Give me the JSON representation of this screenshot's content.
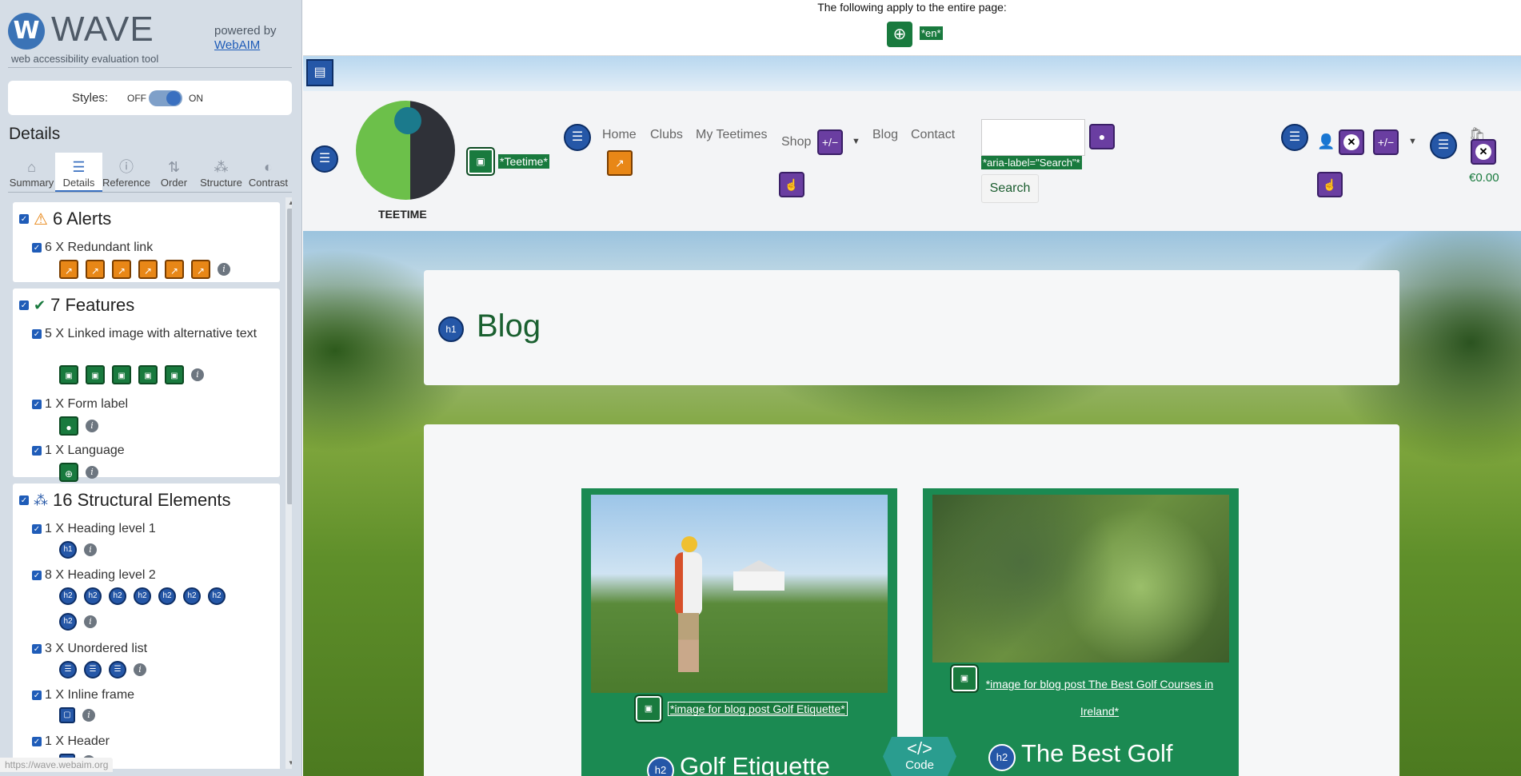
{
  "brand": {
    "name": "WAVE",
    "tagline": "web accessibility evaluation tool",
    "powered_by": "powered by",
    "webaim": "WebAIM"
  },
  "styles": {
    "label": "Styles:",
    "off": "OFF",
    "on": "ON",
    "state": "on"
  },
  "details_title": "Details",
  "tabs": [
    {
      "label": "Summary",
      "icon": "home-icon"
    },
    {
      "label": "Details",
      "icon": "list-icon",
      "active": true
    },
    {
      "label": "Reference",
      "icon": "info-icon"
    },
    {
      "label": "Order",
      "icon": "order-icon"
    },
    {
      "label": "Structure",
      "icon": "structure-icon"
    },
    {
      "label": "Contrast",
      "icon": "contrast-icon"
    }
  ],
  "alerts": {
    "header": "6 Alerts",
    "items": [
      {
        "label": "6 X Redundant link",
        "count": 6
      }
    ]
  },
  "features": {
    "header": "7 Features",
    "items": [
      {
        "label": "5 X Linked image with alternative text",
        "count": 5
      },
      {
        "label": "1 X Form label",
        "count": 1
      },
      {
        "label": "1 X Language",
        "count": 1
      }
    ]
  },
  "structure": {
    "header": "16 Structural Elements",
    "items": [
      {
        "label": "1 X Heading level 1",
        "count": 1,
        "glyph": "h1"
      },
      {
        "label": "8 X Heading level 2",
        "count": 8,
        "glyph": "h2"
      },
      {
        "label": "3 X Unordered list",
        "count": 3
      },
      {
        "label": "1 X Inline frame",
        "count": 1
      },
      {
        "label": "1 X Header",
        "count": 1
      }
    ]
  },
  "status_url": "https://wave.webaim.org",
  "page": {
    "notice": "The following apply to the entire page:",
    "lang_label": "*en*",
    "logo_text": "TEETIME",
    "logo_alt": "*Teetime*",
    "nav": [
      "Home",
      "Clubs",
      "My Teetimes",
      "Shop",
      "Blog",
      "Contact"
    ],
    "aria_label": "*aria-label=\"Search\"*",
    "search_button": "Search",
    "cart_total": "€0.00",
    "blog_title": "Blog",
    "h1_badge": "h1",
    "h2_badge": "h2",
    "posts": [
      {
        "alt": "*image for blog post Golf Etiquette*",
        "title": "Golf Etiquette"
      },
      {
        "alt": "*image for blog post The Best Golf Courses in Ireland*",
        "title": "The Best Golf"
      }
    ]
  },
  "code_toggle": {
    "icon": "</>",
    "label": "Code"
  }
}
